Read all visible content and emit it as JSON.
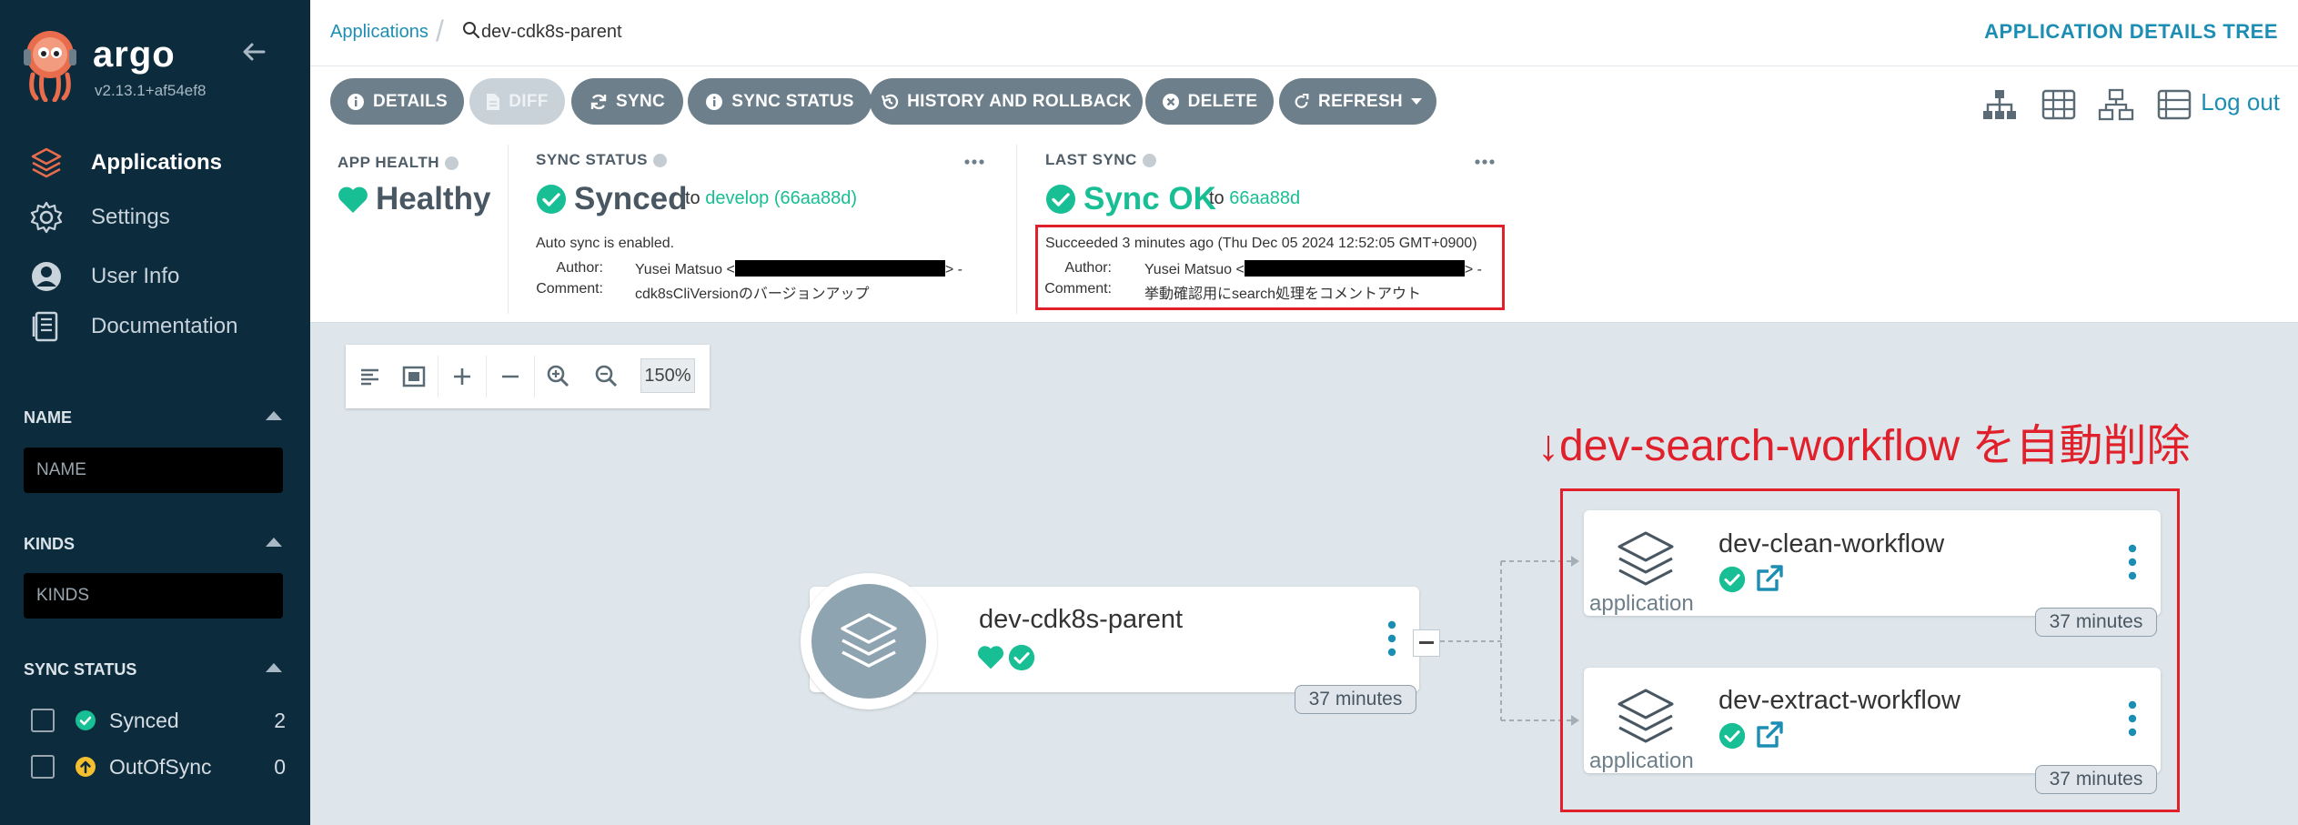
{
  "sidebar": {
    "brand": "argo",
    "version": "v2.13.1+af54ef8",
    "nav": [
      {
        "label": "Applications",
        "icon": "layers-icon"
      },
      {
        "label": "Settings",
        "icon": "gear-icon"
      },
      {
        "label": "User Info",
        "icon": "user-icon"
      },
      {
        "label": "Documentation",
        "icon": "book-icon"
      }
    ],
    "filters": {
      "name_title": "NAME",
      "name_placeholder": "NAME",
      "kinds_title": "KINDS",
      "kinds_placeholder": "KINDS",
      "sync_title": "SYNC STATUS",
      "sync_items": [
        {
          "label": "Synced",
          "count": "2",
          "icon": "check-circle-icon",
          "color": "#18be94"
        },
        {
          "label": "OutOfSync",
          "count": "0",
          "icon": "arrow-up-circle-icon",
          "color": "#f4c030"
        }
      ]
    }
  },
  "header": {
    "breadcrumb_root": "Applications",
    "breadcrumb_current": "dev-cdk8s-parent",
    "title": "APPLICATION DETAILS TREE"
  },
  "toolbar": {
    "buttons": [
      {
        "label": "DETAILS",
        "icon": "info-icon"
      },
      {
        "label": "DIFF",
        "icon": "file-icon",
        "disabled": true
      },
      {
        "label": "SYNC",
        "icon": "sync-icon"
      },
      {
        "label": "SYNC STATUS",
        "icon": "info-icon"
      },
      {
        "label": "HISTORY AND ROLLBACK",
        "icon": "history-icon"
      },
      {
        "label": "DELETE",
        "icon": "times-circle-icon"
      },
      {
        "label": "REFRESH",
        "icon": "redo-icon"
      }
    ],
    "views": [
      "tree-view-icon",
      "pods-view-icon",
      "network-view-icon",
      "list-view-icon"
    ],
    "logout": "Log out"
  },
  "status": {
    "health": {
      "label": "APP HEALTH",
      "value": "Healthy"
    },
    "sync": {
      "label": "SYNC STATUS",
      "value": "Synced",
      "to_prefix": "to",
      "revision": "develop (66aa88d)",
      "auto": "Auto sync is enabled.",
      "author_key": "Author:",
      "author_val_prefix": "Yusei Matsuo <",
      "author_val_suffix": "> -",
      "comment_key": "Comment:",
      "comment_val": "cdk8sCliVersionのバージョンアップ"
    },
    "last_sync": {
      "label": "LAST SYNC",
      "value": "Sync OK",
      "to_prefix": "to",
      "revision": "66aa88d",
      "succeeded": "Succeeded 3 minutes ago (Thu Dec 05 2024 12:52:05 GMT+0900)",
      "author_key": "Author:",
      "author_val_prefix": "Yusei Matsuo <",
      "author_val_suffix": "> -",
      "comment_key": "Comment:",
      "comment_val": "挙動確認用にsearch処理をコメントアウト"
    }
  },
  "zoom": {
    "level": "150%"
  },
  "annotation": "↓dev-search-workflow を自動削除",
  "tree": {
    "parent": {
      "name": "dev-cdk8s-parent",
      "age": "37 minutes"
    },
    "children": [
      {
        "name": "dev-clean-workflow",
        "kind": "application",
        "age": "37 minutes"
      },
      {
        "name": "dev-extract-workflow",
        "kind": "application",
        "age": "37 minutes"
      }
    ]
  },
  "colors": {
    "sidebar_bg": "#0c2b3d",
    "accent": "#1d8eb3",
    "healthy": "#18be94",
    "annotation_red": "#e0202a",
    "button_gray": "#6d7f8b"
  }
}
